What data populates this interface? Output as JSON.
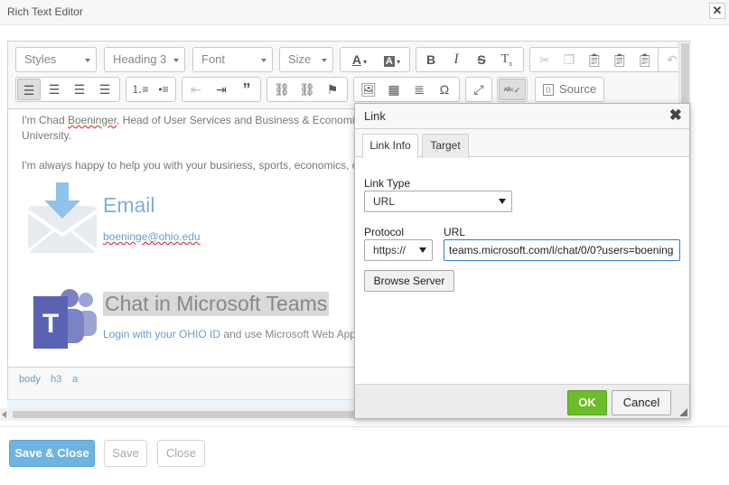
{
  "window": {
    "title": "Rich Text Editor",
    "close_glyph": "✕"
  },
  "toolbar": {
    "styles": "Styles",
    "format": "Heading 3",
    "font": "Font",
    "size": "Size",
    "source_label": "Source"
  },
  "content": {
    "intro_part1": "I'm Chad ",
    "intro_name": "Boeninger",
    "intro_part2": ", Head of User Services and Business & Economi",
    "intro_line2": "University.",
    "help_line": "I'm always happy to help you with your business, sports, economics, o",
    "email_heading": "Email",
    "email_link": "boeninge@ohio.edu",
    "teams_heading": "Chat in Microsoft Teams",
    "teams_link": "Login with your OHIO ID",
    "teams_text": " and use Microsoft Web App"
  },
  "pathbar": {
    "items": [
      "body",
      "h3",
      "a"
    ]
  },
  "footer": {
    "save_close": "Save & Close",
    "save": "Save",
    "close": "Close"
  },
  "dialog": {
    "title": "Link",
    "close_glyph": "✖",
    "tabs": [
      "Link Info",
      "Target"
    ],
    "link_type_label": "Link Type",
    "link_type_value": "URL",
    "protocol_label": "Protocol",
    "protocol_value": "https://",
    "url_label": "URL",
    "url_value": "teams.microsoft.com/l/chat/0/0?users=boening",
    "browse_label": "Browse Server",
    "ok_label": "OK",
    "cancel_label": "Cancel"
  },
  "colors": {
    "accent": "#6fb3e0",
    "ok": "#6bbd29",
    "teams": "#7b83c7",
    "email_icon": "#8fc3ea"
  }
}
